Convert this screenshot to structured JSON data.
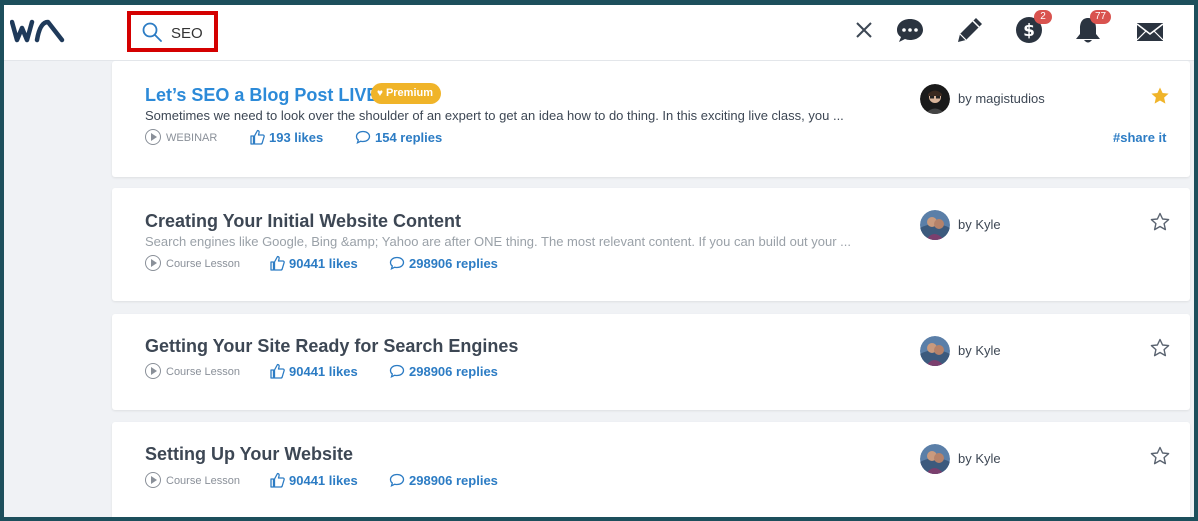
{
  "header": {
    "logo_text": "WA",
    "search": {
      "value": "SEO"
    },
    "icons": [
      "search-icon",
      "close-icon",
      "chat-icon",
      "pencil-icon",
      "dollar-icon",
      "bell-icon",
      "mail-icon"
    ],
    "dollar_badge": "2",
    "bell_badge": "77"
  },
  "colors": {
    "accent_blue": "#2c8ad8",
    "link_blue": "#2c7cc4",
    "premium_gold": "#f0b429",
    "badge_red": "#d9534f",
    "highlight_red": "#d40000",
    "frame": "#1d4f5c"
  },
  "results": [
    {
      "title": "Let’s SEO a Blog Post LIVE!",
      "premium_label": "Premium",
      "description": "Sometimes we need to look over the shoulder of an expert to get an idea how to do thing. In this exciting live class, you ...",
      "type": "WEBINAR",
      "likes": "193 likes",
      "replies": "154 replies",
      "author": "by magistudios",
      "starred": true,
      "share": "#share it"
    },
    {
      "title": "Creating Your Initial Website Content",
      "description": "Search engines like Google, Bing &amp; Yahoo are after ONE thing. The most relevant content. If you can build out your ...",
      "type": "Course Lesson",
      "likes": "90441 likes",
      "replies": "298906 replies",
      "author": "by Kyle",
      "starred": false
    },
    {
      "title": "Getting Your Site Ready for Search Engines",
      "type": "Course Lesson",
      "likes": "90441 likes",
      "replies": "298906 replies",
      "author": "by Kyle",
      "starred": false
    },
    {
      "title": "Setting Up Your Website",
      "type": "Course Lesson",
      "likes": "90441 likes",
      "replies": "298906 replies",
      "author": "by Kyle",
      "starred": false
    }
  ]
}
